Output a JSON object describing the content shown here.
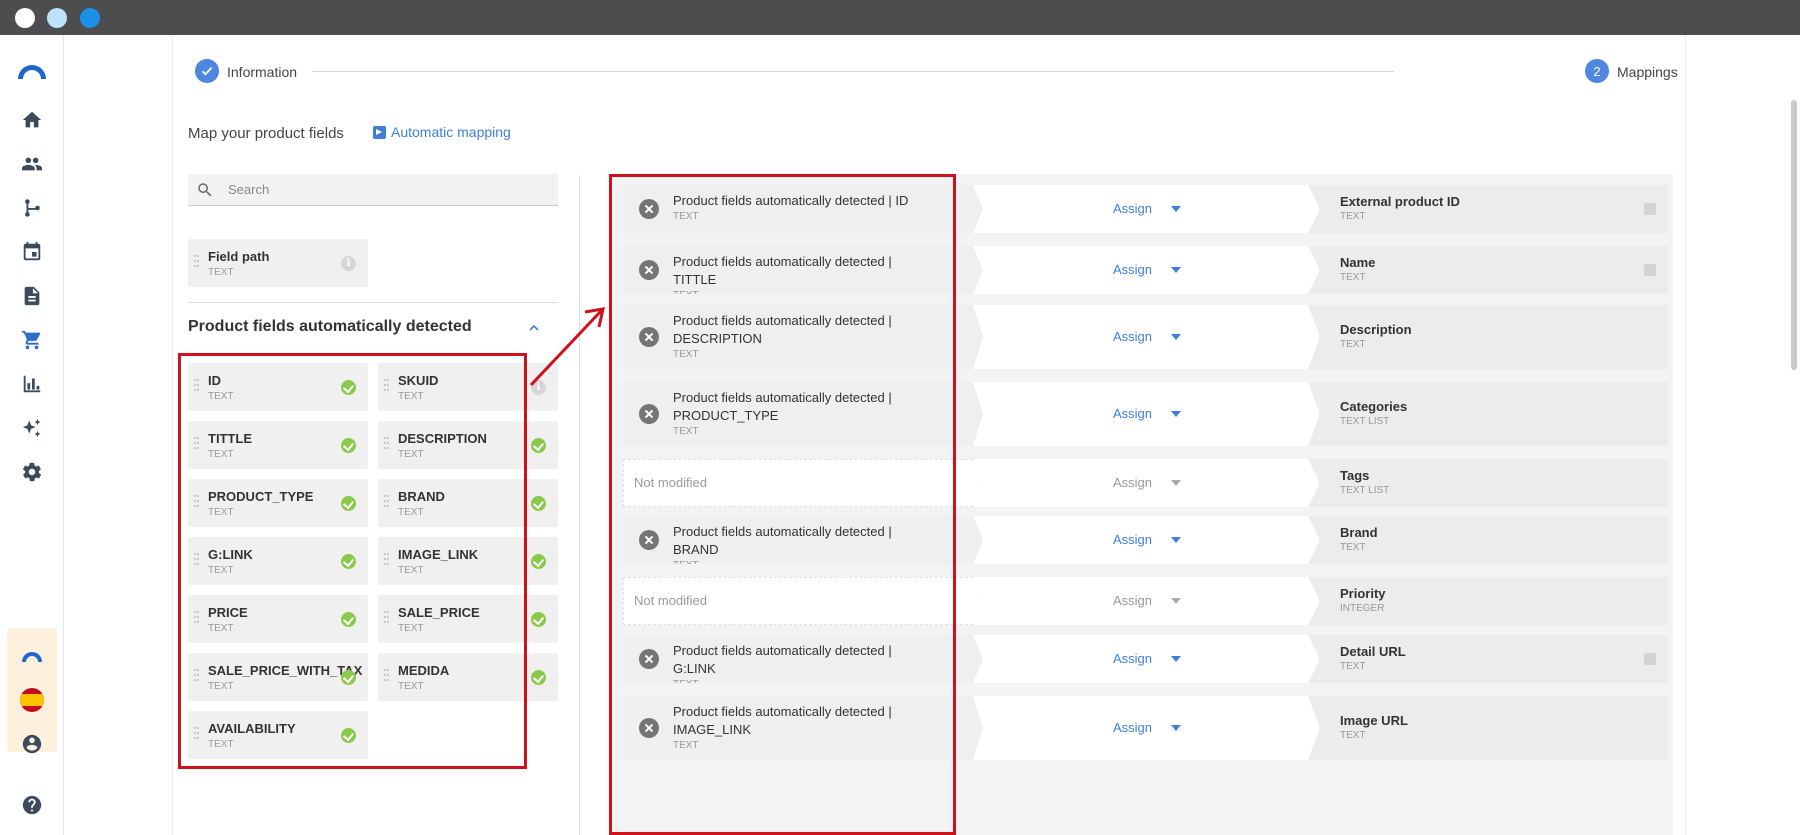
{
  "stepper": {
    "step1_label": "Information",
    "step2_number": "2",
    "step2_label": "Mappings"
  },
  "header": {
    "title": "Map your product fields",
    "auto_mapping": "Automatic mapping"
  },
  "search": {
    "placeholder": "Search"
  },
  "field_path": {
    "name": "Field path",
    "type": "TEXT"
  },
  "section": {
    "title": "Product fields automatically detected"
  },
  "fields": [
    {
      "name": "ID",
      "type": "TEXT",
      "status": "ok"
    },
    {
      "name": "SKUID",
      "type": "TEXT",
      "status": "info"
    },
    {
      "name": "TITTLE",
      "type": "TEXT",
      "status": "ok"
    },
    {
      "name": "DESCRIPTION",
      "type": "TEXT",
      "status": "ok"
    },
    {
      "name": "PRODUCT_TYPE",
      "type": "TEXT",
      "status": "ok"
    },
    {
      "name": "BRAND",
      "type": "TEXT",
      "status": "ok"
    },
    {
      "name": "G:LINK",
      "type": "TEXT",
      "status": "ok"
    },
    {
      "name": "IMAGE_LINK",
      "type": "TEXT",
      "status": "ok"
    },
    {
      "name": "PRICE",
      "type": "TEXT",
      "status": "ok"
    },
    {
      "name": "SALE_PRICE",
      "type": "TEXT",
      "status": "ok"
    },
    {
      "name": "SALE_PRICE_WITH_TAX",
      "type": "TEXT",
      "status": "ok"
    },
    {
      "name": "MEDIDA",
      "type": "TEXT",
      "status": "ok"
    },
    {
      "name": "AVAILABILITY",
      "type": "TEXT",
      "status": "ok"
    }
  ],
  "mappings": [
    {
      "source_line1": "Product fields automatically detected | ID",
      "source_line2": "",
      "source_type": "TEXT",
      "assign": "Assign",
      "target": "External product ID",
      "target_type": "TEXT",
      "info": true
    },
    {
      "source_line1": "Product fields automatically detected | TITTLE",
      "source_line2": "",
      "source_type": "TEXT",
      "assign": "Assign",
      "target": "Name",
      "target_type": "TEXT",
      "info": true
    },
    {
      "source_line1": "Product fields automatically detected |",
      "source_line2": "DESCRIPTION",
      "source_type": "TEXT",
      "assign": "Assign",
      "target": "Description",
      "target_type": "TEXT",
      "info": false
    },
    {
      "source_line1": "Product fields automatically detected |",
      "source_line2": "PRODUCT_TYPE",
      "source_type": "TEXT",
      "assign": "Assign",
      "target": "Categories",
      "target_type": "TEXT LIST",
      "info": false
    },
    {
      "empty": true,
      "source_line1": "Not modified",
      "assign": "Assign",
      "target": "Tags",
      "target_type": "TEXT LIST",
      "info": false
    },
    {
      "source_line1": "Product fields automatically detected | BRAND",
      "source_line2": "",
      "source_type": "TEXT",
      "assign": "Assign",
      "target": "Brand",
      "target_type": "TEXT",
      "info": false
    },
    {
      "empty": true,
      "source_line1": "Not modified",
      "assign": "Assign",
      "target": "Priority",
      "target_type": "INTEGER",
      "info": false
    },
    {
      "source_line1": "Product fields automatically detected | G:LINK",
      "source_line2": "",
      "source_type": "TEXT",
      "assign": "Assign",
      "target": "Detail URL",
      "target_type": "TEXT",
      "info": true
    },
    {
      "source_line1": "Product fields automatically detected |",
      "source_line2": "IMAGE_LINK",
      "source_type": "TEXT",
      "assign": "Assign",
      "target": "Image URL",
      "target_type": "TEXT",
      "info": false
    }
  ],
  "colors": {
    "accent": "#3f7fd8",
    "ok_green": "#8bc94a",
    "highlight_red": "#d0101b"
  }
}
